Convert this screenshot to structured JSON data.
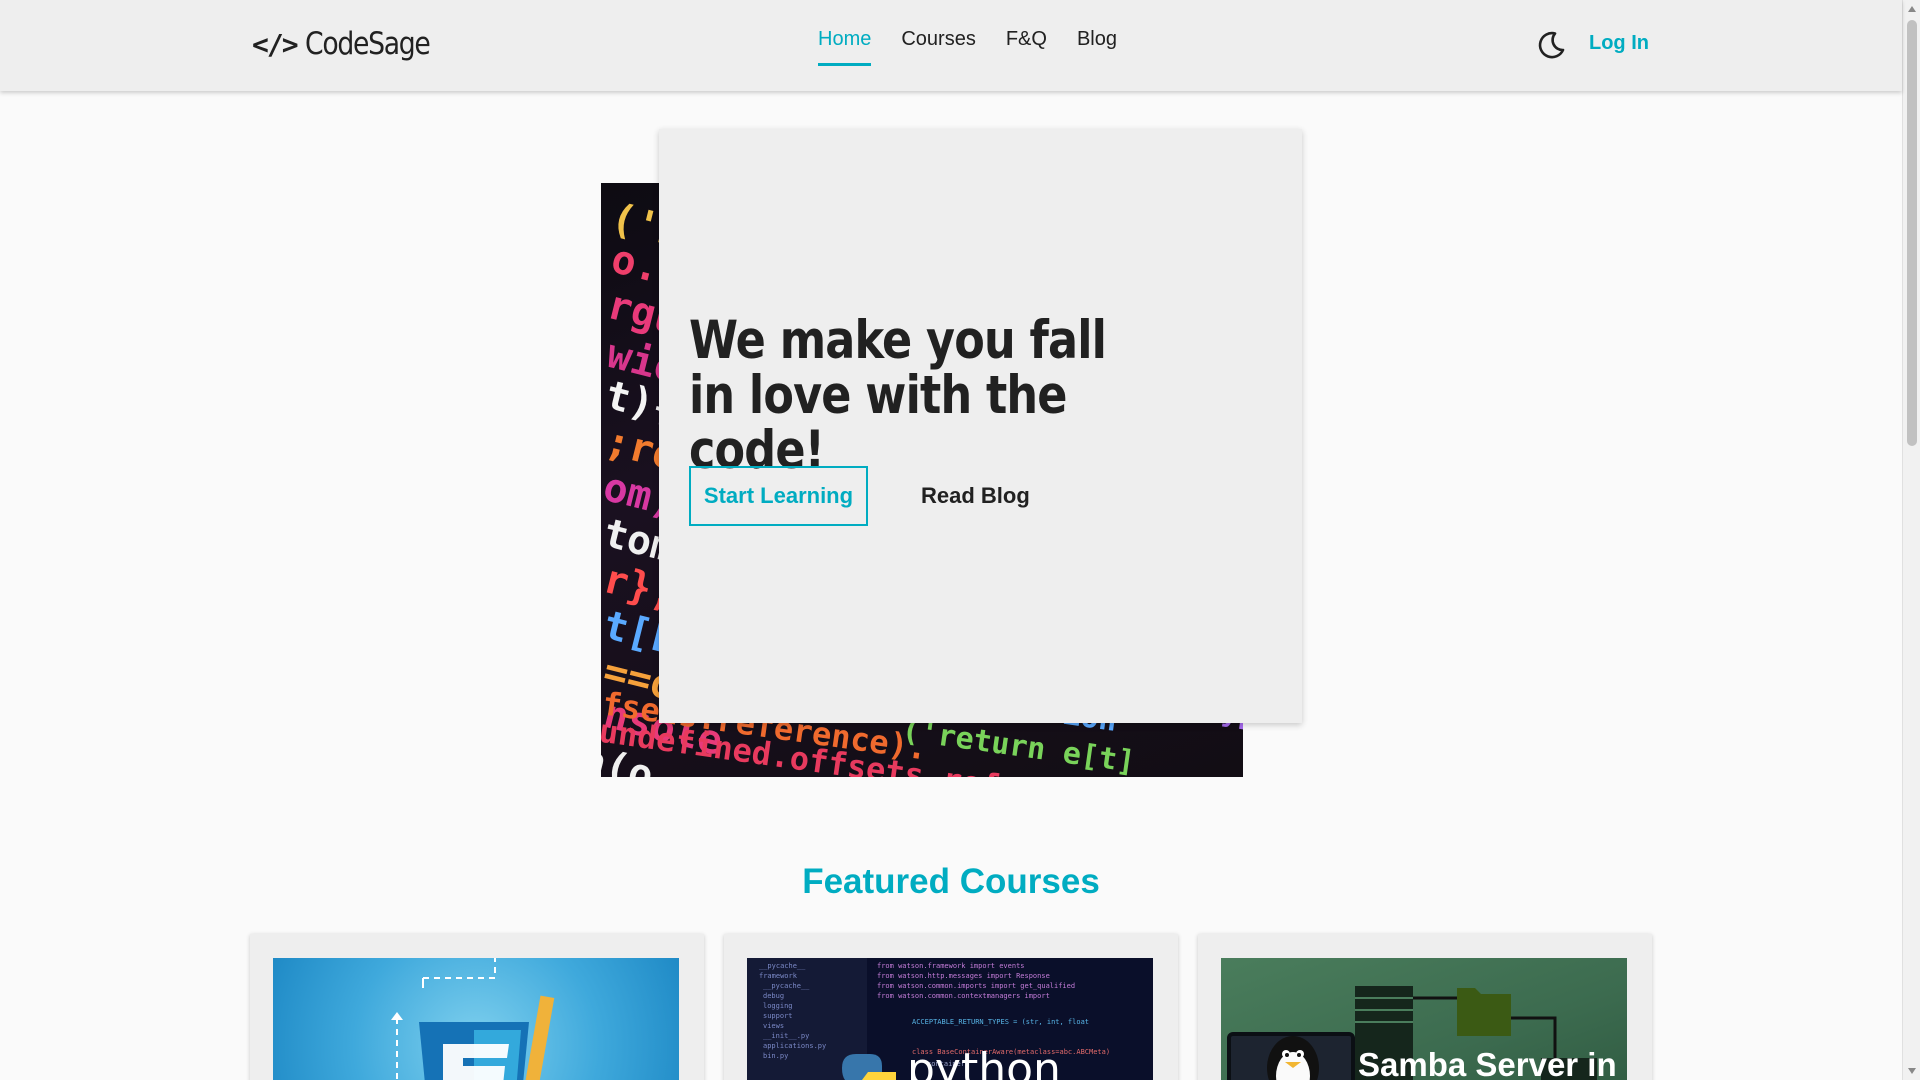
{
  "app": {
    "logo_symbol": "</>",
    "brand": "CodeSage",
    "accent_color": "#00acc1"
  },
  "nav": {
    "items": [
      {
        "label": "Home",
        "active": true
      },
      {
        "label": "Courses",
        "active": false
      },
      {
        "label": "F&Q",
        "active": false
      },
      {
        "label": "Blog",
        "active": false
      }
    ],
    "theme_icon": "moon-icon",
    "login_label": "Log In"
  },
  "hero": {
    "title": "We make you fall in love with the code!",
    "primary_button": "Start Learning",
    "secondary_button": "Read Blog",
    "image_alt": "code-screen-image"
  },
  "featured": {
    "title": "Featured Courses",
    "courses": [
      {
        "image_label": ""
      },
      {
        "image_label": "python"
      },
      {
        "image_label": "Samba Server in"
      }
    ]
  }
}
